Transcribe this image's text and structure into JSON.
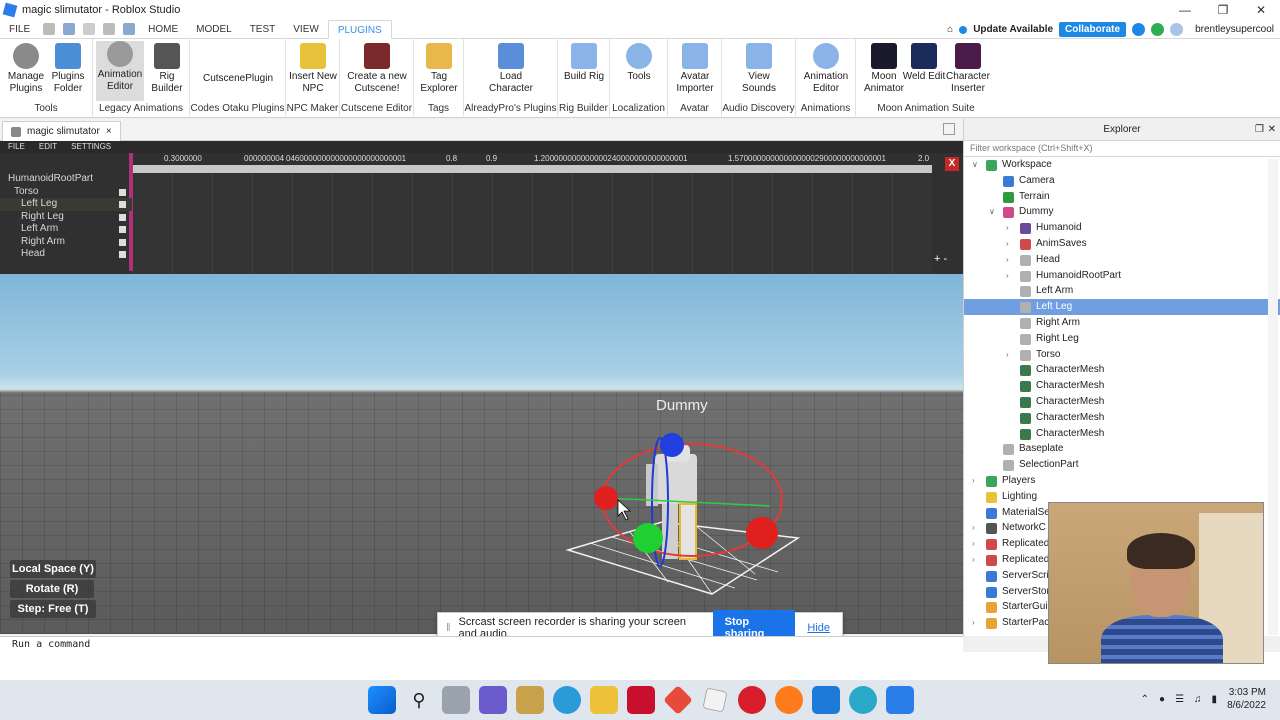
{
  "window": {
    "title": "magic slimutator - Roblox Studio"
  },
  "menu": {
    "tabs": [
      "FILE",
      "HOME",
      "MODEL",
      "TEST",
      "VIEW",
      "PLUGINS"
    ],
    "active": "PLUGINS",
    "update_label": "Update Available",
    "collaborate_label": "Collaborate",
    "username": "brentleysupercool"
  },
  "ribbon": {
    "groups": [
      {
        "caption": "Tools",
        "buttons": [
          "Manage Plugins",
          "Plugins Folder"
        ]
      },
      {
        "caption": "Legacy Animations",
        "buttons": [
          "Animation Editor",
          "Rig Builder"
        ]
      },
      {
        "caption": "Codes Otaku Plugins",
        "buttons": [
          "CutscenePlugin"
        ]
      },
      {
        "caption": "NPC Maker",
        "buttons": [
          "Insert New NPC"
        ]
      },
      {
        "caption": "Cutscene Editor",
        "buttons": [
          "Create a new Cutscene!"
        ]
      },
      {
        "caption": "Tags",
        "buttons": [
          "Tag Explorer"
        ]
      },
      {
        "caption": "AlreadyPro's Plugins",
        "buttons": [
          "Load Character"
        ]
      },
      {
        "caption": "Rig Builder",
        "buttons": [
          "Build Rig"
        ]
      },
      {
        "caption": "Localization",
        "buttons": [
          "Tools"
        ]
      },
      {
        "caption": "Avatar",
        "buttons": [
          "Avatar Importer"
        ]
      },
      {
        "caption": "Audio Discovery",
        "buttons": [
          "View Sounds"
        ]
      },
      {
        "caption": "Animations",
        "buttons": [
          "Animation Editor"
        ]
      },
      {
        "caption": "Moon Animation Suite",
        "buttons": [
          "Moon Animator",
          "Weld Edit",
          "Character Inserter"
        ]
      }
    ]
  },
  "doc_tab": {
    "label": "magic slimutator",
    "close": "×"
  },
  "anim_editor": {
    "menu": [
      "FILE",
      "EDIT",
      "SETTINGS"
    ],
    "ruler": [
      "0.3000000                   000000004",
      "046000000000000000000000001",
      "0.8",
      "0.9",
      "1.200000000000000240000000000000001",
      "1.5700000000000000002900000000000001",
      "2.0"
    ],
    "parts": [
      "HumanoidRootPart",
      "Torso",
      "Left Leg",
      "Right Leg",
      "Left Arm",
      "Right Arm",
      "Head"
    ],
    "close": "X",
    "zoom": "+ -"
  },
  "viewport": {
    "dummy_label": "Dummy",
    "buttons": [
      "Local Space (Y)",
      "Rotate (R)",
      "Step: Free (T)"
    ]
  },
  "share_toast": {
    "message": "Scrcast screen recorder is sharing your screen and audio.",
    "stop": "Stop sharing",
    "hide": "Hide"
  },
  "command_bar": {
    "placeholder": "Run a command"
  },
  "explorer": {
    "title": "Explorer",
    "filter_placeholder": "Filter workspace (Ctrl+Shift+X)",
    "nodes": [
      {
        "label": "Workspace",
        "depth": 0,
        "arrow": "open",
        "icon": "workspace-icon",
        "color": "#3aa55d"
      },
      {
        "label": "Camera",
        "depth": 1,
        "arrow": "",
        "icon": "camera-icon",
        "color": "#3a7bd5"
      },
      {
        "label": "Terrain",
        "depth": 1,
        "arrow": "",
        "icon": "terrain-icon",
        "color": "#2e9a3e"
      },
      {
        "label": "Dummy",
        "depth": 1,
        "arrow": "open",
        "icon": "model-icon",
        "color": "#d04a8a"
      },
      {
        "label": "Humanoid",
        "depth": 2,
        "arrow": "closed",
        "icon": "humanoid-icon",
        "color": "#6a4a9a"
      },
      {
        "label": "AnimSaves",
        "depth": 2,
        "arrow": "closed",
        "icon": "model-icon",
        "color": "#d04a4a"
      },
      {
        "label": "Head",
        "depth": 2,
        "arrow": "closed",
        "icon": "part-icon",
        "color": "#b0b0b0"
      },
      {
        "label": "HumanoidRootPart",
        "depth": 2,
        "arrow": "closed",
        "icon": "part-icon",
        "color": "#b0b0b0"
      },
      {
        "label": "Left Arm",
        "depth": 2,
        "arrow": "",
        "icon": "part-icon",
        "color": "#b0b0b0"
      },
      {
        "label": "Left Leg",
        "depth": 2,
        "arrow": "",
        "icon": "part-icon",
        "color": "#b0b0b0",
        "selected": true
      },
      {
        "label": "Right Arm",
        "depth": 2,
        "arrow": "",
        "icon": "part-icon",
        "color": "#b0b0b0"
      },
      {
        "label": "Right Leg",
        "depth": 2,
        "arrow": "",
        "icon": "part-icon",
        "color": "#b0b0b0"
      },
      {
        "label": "Torso",
        "depth": 2,
        "arrow": "closed",
        "icon": "part-icon",
        "color": "#b0b0b0"
      },
      {
        "label": "CharacterMesh",
        "depth": 2,
        "arrow": "",
        "icon": "mesh-icon",
        "color": "#3a7a4a"
      },
      {
        "label": "CharacterMesh",
        "depth": 2,
        "arrow": "",
        "icon": "mesh-icon",
        "color": "#3a7a4a"
      },
      {
        "label": "CharacterMesh",
        "depth": 2,
        "arrow": "",
        "icon": "mesh-icon",
        "color": "#3a7a4a"
      },
      {
        "label": "CharacterMesh",
        "depth": 2,
        "arrow": "",
        "icon": "mesh-icon",
        "color": "#3a7a4a"
      },
      {
        "label": "CharacterMesh",
        "depth": 2,
        "arrow": "",
        "icon": "mesh-icon",
        "color": "#3a7a4a"
      },
      {
        "label": "Baseplate",
        "depth": 1,
        "arrow": "",
        "icon": "part-icon",
        "color": "#b0b0b0"
      },
      {
        "label": "SelectionPart",
        "depth": 1,
        "arrow": "",
        "icon": "part-icon",
        "color": "#b0b0b0"
      },
      {
        "label": "Players",
        "depth": 0,
        "arrow": "closed",
        "icon": "players-icon",
        "color": "#3aa55d"
      },
      {
        "label": "Lighting",
        "depth": 0,
        "arrow": "",
        "icon": "lighting-icon",
        "color": "#e8c23a"
      },
      {
        "label": "MaterialSe",
        "depth": 0,
        "arrow": "",
        "icon": "material-icon",
        "color": "#3a7bd5"
      },
      {
        "label": "NetworkC",
        "depth": 0,
        "arrow": "closed",
        "icon": "network-icon",
        "color": "#555555"
      },
      {
        "label": "Replicated",
        "depth": 0,
        "arrow": "closed",
        "icon": "replicated-icon",
        "color": "#d04a4a"
      },
      {
        "label": "Replicated",
        "depth": 0,
        "arrow": "closed",
        "icon": "replicated-icon",
        "color": "#d04a4a"
      },
      {
        "label": "ServerScrip",
        "depth": 0,
        "arrow": "",
        "icon": "server-icon",
        "color": "#3a7bd5"
      },
      {
        "label": "ServerStor",
        "depth": 0,
        "arrow": "",
        "icon": "server-icon",
        "color": "#3a7bd5"
      },
      {
        "label": "StarterGui",
        "depth": 0,
        "arrow": "",
        "icon": "starter-icon",
        "color": "#e8a23a"
      },
      {
        "label": "StarterPac",
        "depth": 0,
        "arrow": "closed",
        "icon": "starter-icon",
        "color": "#e8a23a"
      }
    ]
  },
  "taskbar": {
    "time": "3:03 PM",
    "date": "8/6/2022"
  }
}
